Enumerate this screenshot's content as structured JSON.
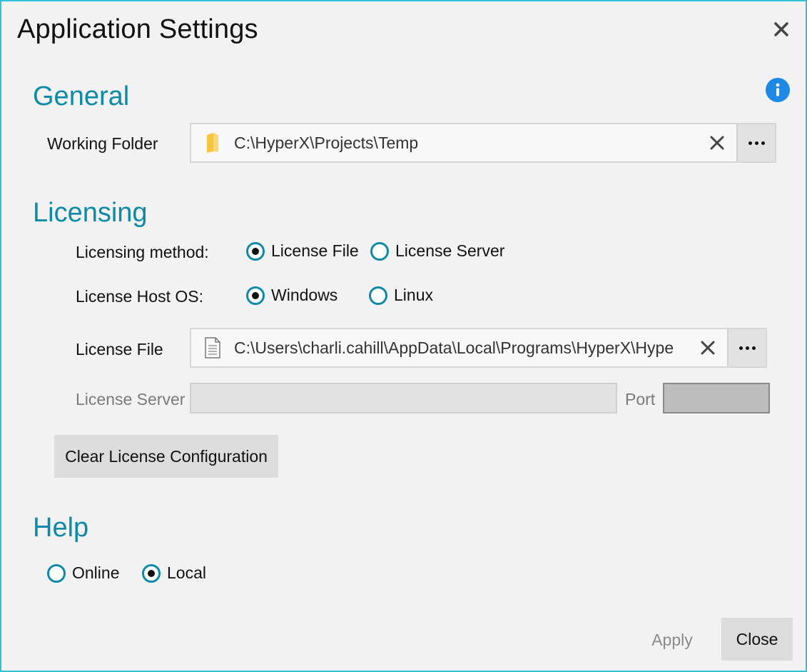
{
  "dialog": {
    "title": "Application Settings"
  },
  "general": {
    "heading": "General",
    "working_folder_label": "Working Folder",
    "working_folder_value": "C:\\HyperX\\Projects\\Temp"
  },
  "licensing": {
    "heading": "Licensing",
    "method_label": "Licensing method:",
    "method_options": [
      "License File",
      "License Server"
    ],
    "method_selected": "License File",
    "host_os_label": "License Host OS:",
    "host_os_options": [
      "Windows",
      "Linux"
    ],
    "host_os_selected": "Windows",
    "license_file_label": "License File",
    "license_file_value": "C:\\Users\\charli.cahill\\AppData\\Local\\Programs\\HyperX\\Hype",
    "license_server_label": "License Server",
    "port_label": "Port",
    "clear_button": "Clear License Configuration"
  },
  "help": {
    "heading": "Help",
    "options": [
      "Online",
      "Local"
    ],
    "selected": "Local"
  },
  "footer": {
    "apply_label": "Apply",
    "close_label": "Close"
  },
  "colors": {
    "accent": "#0e8aa6",
    "border": "#2ec4d6",
    "info": "#1e88e5"
  }
}
